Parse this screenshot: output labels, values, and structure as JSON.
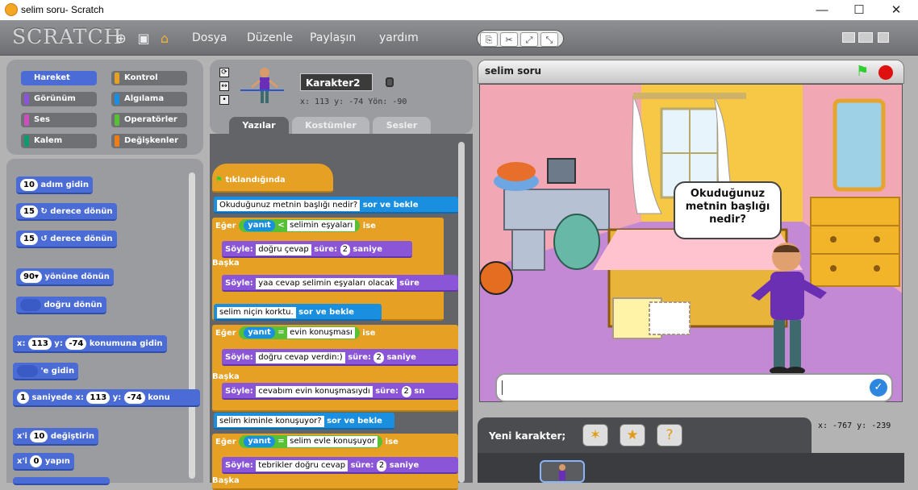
{
  "window": {
    "title": "selim soru- Scratch",
    "min": "—",
    "max": "☐",
    "close": "✕"
  },
  "menu": {
    "logo": "SCRATCH",
    "items": [
      "Dosya",
      "Düzenle",
      "Paylaşın",
      "yardım"
    ]
  },
  "categories": [
    {
      "label": "Hareket",
      "color": "#4a6cd4"
    },
    {
      "label": "Kontrol",
      "color": "#e6a023"
    },
    {
      "label": "Görünüm",
      "color": "#8a55d7"
    },
    {
      "label": "Algılama",
      "color": "#1a8fe0"
    },
    {
      "label": "Ses",
      "color": "#cc4fbf"
    },
    {
      "label": "Operatörler",
      "color": "#58c036"
    },
    {
      "label": "Kalem",
      "color": "#0e9a6c"
    },
    {
      "label": "Değişkenler",
      "color": "#ee7d16"
    }
  ],
  "palette": {
    "b1": {
      "n": "10",
      "t": "adım gidin"
    },
    "b2": {
      "n": "15",
      "t": "derece dönün"
    },
    "b3": {
      "n": "15",
      "t": "derece dönün"
    },
    "b4": {
      "n": "90▾",
      "t": "yönüne dönün"
    },
    "b5": {
      "t": "doğru dönün"
    },
    "b6": {
      "a": "x:",
      "n1": "113",
      "b": "y:",
      "n2": "-74",
      "t": "konumuna gidin"
    },
    "b7": {
      "t": "'e gidin"
    },
    "b8": {
      "n": "1",
      "a": "saniyede x:",
      "n1": "113",
      "b": "y:",
      "n2": "-74",
      "t": "konu"
    },
    "b9": {
      "a": "x'i",
      "n": "10",
      "t": "değiştirin"
    },
    "b10": {
      "a": "x'i",
      "n": "0",
      "t": "yapın"
    }
  },
  "sprite": {
    "name": "Karakter2",
    "info": "x: 113  y: -74   Yön: -90"
  },
  "tabs": [
    "Yazılar",
    "Kostümler",
    "Sesler"
  ],
  "script": {
    "hat": "tıklandığında",
    "ask1": "Okuduğunuz metnin başlığı nedir?",
    "askw": "sor ve bekle",
    "if": "Eğer",
    "yanit": "yanıt",
    "lt": "<",
    "eq": "=",
    "ise": "ise",
    "c1": "selimin eşyaları",
    "say": "Söyle:",
    "sure": "süre:",
    "two": "2",
    "saniye": "saniye",
    "s1": "doğru çevap",
    "else": "Başka",
    "s2": "yaa cevap selimin eşyaları olacak",
    "surecut": "süre",
    "ask2": "selim niçin korktu.",
    "c2": "evin konuşması",
    "s3": "doğru cevap verdin:)",
    "s4": "cevabım evin konuşmasıydı",
    "sn": "sn",
    "ask3": "selim kiminle konuşuyor?",
    "c3": "selim evle konuşuyor",
    "s5": "tebrikler doğru cevap",
    "else2": "Başka"
  },
  "stage": {
    "title": "selim soru",
    "bubble": "Okuduğunuz metnin başlığı nedir?",
    "coords": "x: -767   y: -239"
  },
  "sprites": {
    "label": "Yeni karakter;"
  }
}
